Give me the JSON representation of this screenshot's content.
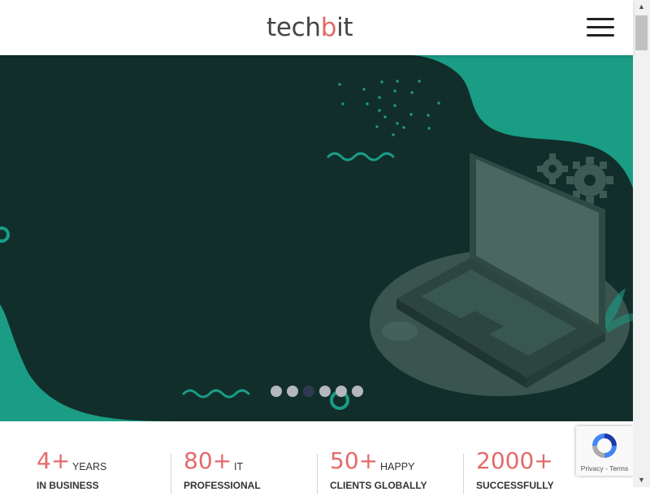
{
  "header": {
    "logo_prefix": "tech",
    "logo_accent": "b",
    "logo_suffix": "it",
    "menu_icon": "hamburger-menu-icon"
  },
  "hero": {
    "illustration": "laptop-gears-illustration",
    "slides_count": 6,
    "active_slide": 3,
    "colors": {
      "teal": "#1a9c85",
      "dark_green": "#112e2a"
    }
  },
  "stats": [
    {
      "number": "4+",
      "label": "YEARS",
      "sub": "IN BUSINESS"
    },
    {
      "number": "80+",
      "label": "IT",
      "sub": "PROFESSIONAL"
    },
    {
      "number": "50+",
      "label": "HAPPY",
      "sub": "CLIENTS GLOBALLY"
    },
    {
      "number": "2000+",
      "label": "",
      "sub": "SUCCESSFULLY"
    }
  ],
  "recaptcha": {
    "links": "Privacy - Terms",
    "icon": "recaptcha-icon"
  },
  "colors": {
    "accent": "#e46a6a",
    "text": "#333333"
  }
}
